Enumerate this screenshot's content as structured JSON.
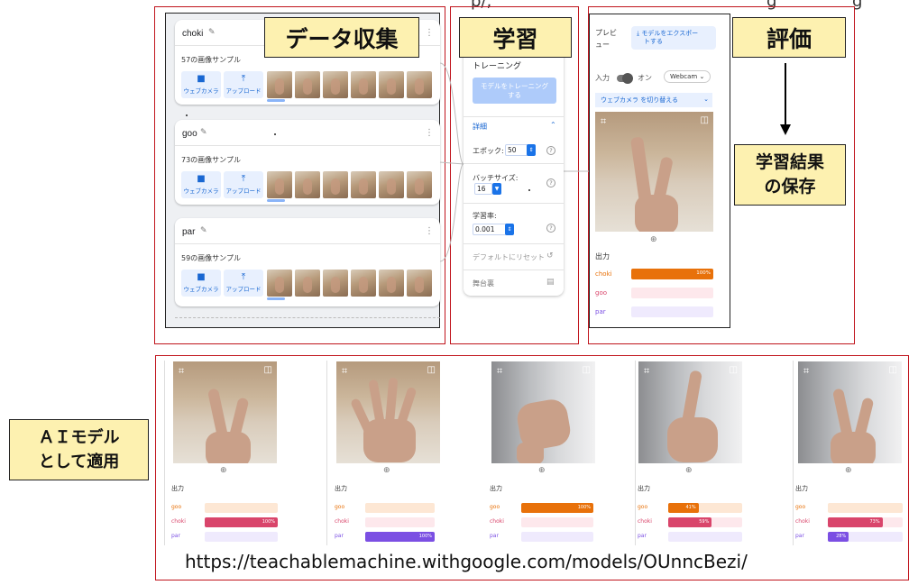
{
  "top_cut_text": [
    "p/,",
    "g",
    "g"
  ],
  "callouts": {
    "data_collection": "データ収集",
    "training": "学習",
    "evaluation": "評価",
    "save_result": [
      "学習結果",
      "の保存"
    ],
    "apply_model": [
      "ＡＩモデル",
      "として適用"
    ]
  },
  "classes": [
    {
      "name": "choki",
      "samples": "57の画像サンプル"
    },
    {
      "name": "goo",
      "samples": "73の画像サンプル"
    },
    {
      "name": "par",
      "samples": "59の画像サンプル"
    }
  ],
  "capture_buttons": {
    "webcam": "ウェブカメラ",
    "upload": "アップロード"
  },
  "training": {
    "title": "トレーニング",
    "train_button": [
      "モデルをトレーニング",
      "する"
    ],
    "advanced": "詳細",
    "epochs_label": "エポック:",
    "epochs_value": "50",
    "batch_label": "バッチサイズ:",
    "batch_value": "16",
    "lr_label": "学習率:",
    "lr_value": "0.001",
    "reset": "デフォルトにリセット",
    "dashboard": "舞台裏"
  },
  "preview": {
    "title": [
      "プレビ",
      "ュー"
    ],
    "export_button": [
      "モデルをエクスポー",
      "トする"
    ],
    "input_label": "入力",
    "toggle_label": "オン",
    "source": "Webcam",
    "switch_camera": "ウェブカメラ を切り替える",
    "output_label": "出力",
    "bars": [
      {
        "label": "choki",
        "value": 100,
        "pct": "100%",
        "color": "#e8710a",
        "bg": "#fde7d4"
      },
      {
        "label": "goo",
        "value": 0,
        "pct": "",
        "color": "#d9456b",
        "bg": "#fde8ec"
      },
      {
        "label": "par",
        "value": 0,
        "pct": "",
        "color": "#7b4fe3",
        "bg": "#efeafd"
      }
    ]
  },
  "applied": {
    "output_label": "出力",
    "panels": [
      {
        "bars": [
          {
            "label": "goo",
            "value": 0,
            "pct": "",
            "color": "#e8710a",
            "bg": "#fde7d4"
          },
          {
            "label": "choki",
            "value": 100,
            "pct": "100%",
            "color": "#d9456b",
            "bg": "#fde8ec"
          },
          {
            "label": "par",
            "value": 0,
            "pct": "",
            "color": "#7b4fe3",
            "bg": "#efeafd"
          }
        ]
      },
      {
        "bars": [
          {
            "label": "goo",
            "value": 0,
            "pct": "",
            "color": "#e8710a",
            "bg": "#fde7d4"
          },
          {
            "label": "choki",
            "value": 0,
            "pct": "",
            "color": "#d9456b",
            "bg": "#fde8ec"
          },
          {
            "label": "par",
            "value": 100,
            "pct": "100%",
            "color": "#7b4fe3",
            "bg": "#efeafd"
          }
        ]
      },
      {
        "bars": [
          {
            "label": "goo",
            "value": 100,
            "pct": "100%",
            "color": "#e8710a",
            "bg": "#fde7d4"
          },
          {
            "label": "choki",
            "value": 0,
            "pct": "",
            "color": "#d9456b",
            "bg": "#fde8ec"
          },
          {
            "label": "par",
            "value": 0,
            "pct": "",
            "color": "#7b4fe3",
            "bg": "#efeafd"
          }
        ]
      },
      {
        "bars": [
          {
            "label": "goo",
            "value": 41,
            "pct": "41%",
            "color": "#e8710a",
            "bg": "#fde7d4"
          },
          {
            "label": "choki",
            "value": 59,
            "pct": "59%",
            "color": "#d9456b",
            "bg": "#fde8ec"
          },
          {
            "label": "par",
            "value": 0,
            "pct": "",
            "color": "#7b4fe3",
            "bg": "#efeafd"
          }
        ]
      },
      {
        "bars": [
          {
            "label": "goo",
            "value": 0,
            "pct": "",
            "color": "#e8710a",
            "bg": "#fde7d4"
          },
          {
            "label": "choki",
            "value": 73,
            "pct": "73%",
            "color": "#d9456b",
            "bg": "#fde8ec"
          },
          {
            "label": "par",
            "value": 28,
            "pct": "28%",
            "color": "#7b4fe3",
            "bg": "#efeafd"
          }
        ]
      }
    ]
  },
  "url": "https://teachablemachine.withgoogle.com/models/OUnncBezi/"
}
